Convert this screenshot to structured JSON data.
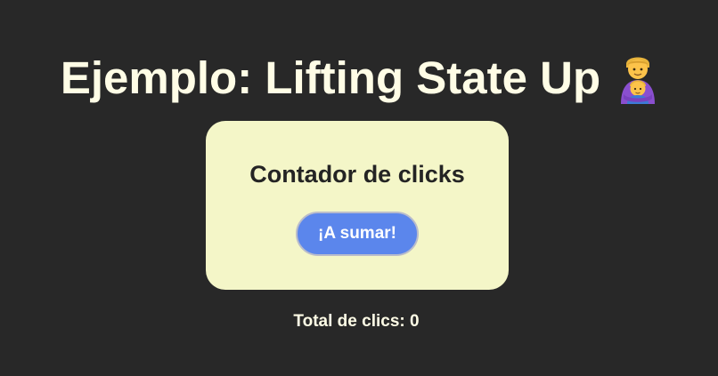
{
  "header": {
    "title": "Ejemplo: Lifting State Up",
    "emoji_icon": "man-with-child-emoji-icon"
  },
  "counter_card": {
    "title": "Contador de clicks",
    "button_label": "¡A sumar!"
  },
  "total": {
    "text": "Total de clics: 0"
  },
  "colors": {
    "background": "#282828",
    "text_light": "#fffde6",
    "card_bg": "#f4f6c8",
    "button_bg": "#5b86ec"
  }
}
